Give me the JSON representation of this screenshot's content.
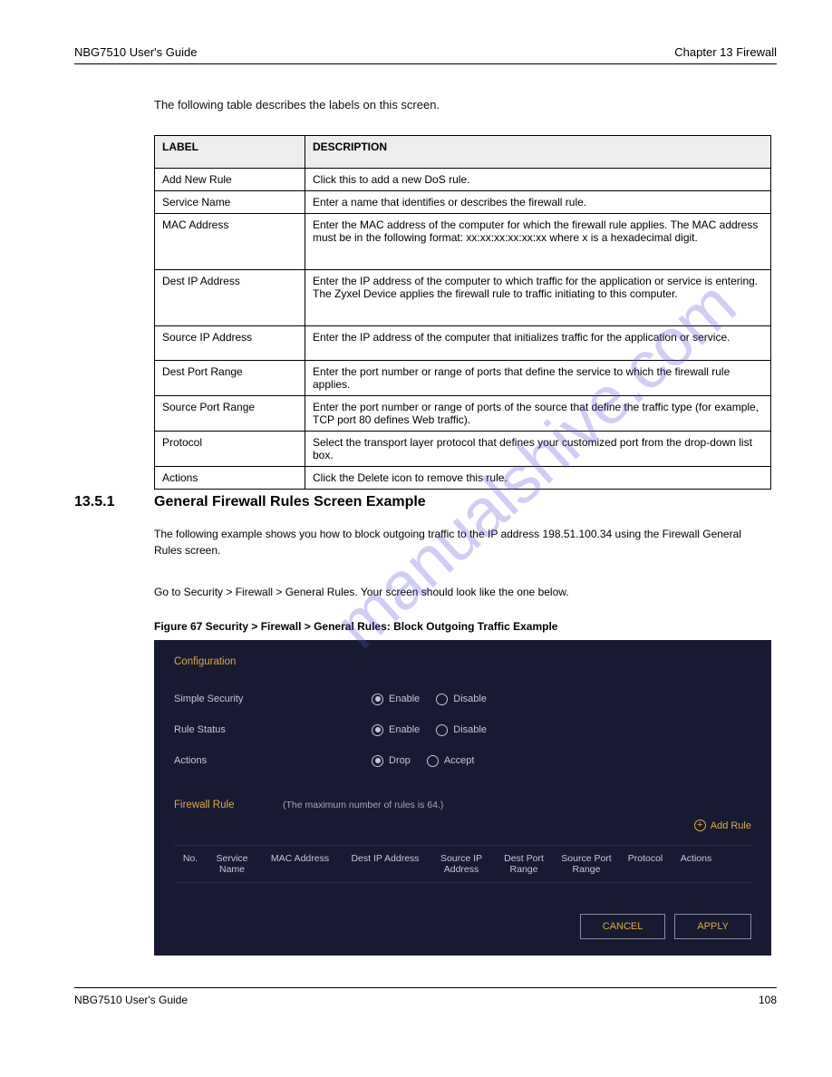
{
  "header": {
    "left": "NBG7510 User's Guide",
    "right": "Chapter 13 Firewall"
  },
  "intro_line": "The following table describes the labels on this screen.",
  "table": {
    "th_label": "LABEL",
    "th_desc": "DESCRIPTION",
    "rows": [
      {
        "label": "Add New Rule",
        "desc": "Click this to add a new DoS rule.",
        "cls": "h1"
      },
      {
        "label": "Service Name",
        "desc": "Enter a name that identifies or describes the firewall rule.",
        "cls": "h1"
      },
      {
        "label": "MAC Address",
        "desc": "Enter the MAC address of the computer for which the firewall rule applies. The MAC address must be in the following format: xx:xx:xx:xx:xx:xx where x is a hexadecimal digit.",
        "cls": "h2"
      },
      {
        "label": "Dest IP Address",
        "desc": "Enter the IP address of the computer to which traffic for the application or service is entering. The Zyxel Device applies the firewall rule to traffic initiating to this computer.",
        "cls": "h2"
      },
      {
        "label": "Source IP Address",
        "desc": "Enter the IP address of the computer that initializes traffic for the application or service.",
        "cls": "h3"
      },
      {
        "label": "Dest Port Range",
        "desc": "Enter the port number or range of ports that define the service to which the firewall rule applies.",
        "cls": "h3"
      },
      {
        "label": "Source Port Range",
        "desc": "Enter the port number or range of ports of the source that define the traffic type (for example, TCP port 80 defines Web traffic).",
        "cls": "h3"
      },
      {
        "label": "Protocol",
        "desc": "Select the transport layer protocol that defines your customized port from the drop-down list box.",
        "cls": "h1"
      },
      {
        "label": "Actions",
        "desc": "Click the Delete icon to remove this rule.",
        "cls": "h1"
      }
    ]
  },
  "section": {
    "number": "13.5.1",
    "title": "General Firewall Rules Screen Example",
    "para1": "The following example shows you how to block outgoing traffic to the IP address 198.51.100.34 using the Firewall General Rules screen.",
    "para2": "Go to Security > Firewall > General Rules. Your screen should look like the one below.",
    "figure_caption": "Figure 67   Security > Firewall > General Rules: Block Outgoing Traffic Example"
  },
  "ui": {
    "config_title": "Configuration",
    "simple_security": {
      "label": "Simple Security",
      "opt1": "Enable",
      "opt2": "Disable",
      "selected": "Enable"
    },
    "rule_status": {
      "label": "Rule Status",
      "opt1": "Enable",
      "opt2": "Disable",
      "selected": "Enable"
    },
    "actions": {
      "label": "Actions",
      "opt1": "Drop",
      "opt2": "Accept",
      "selected": "Drop"
    },
    "firewall_rule_title": "Firewall Rule",
    "firewall_rule_note": "(The maximum number of rules is 64.)",
    "add_rule": "Add Rule",
    "cols": {
      "no": "No.",
      "svc": "Service Name",
      "mac": "MAC Address",
      "dip": "Dest IP Address",
      "sip": "Source IP Address",
      "dpr": "Dest Port Range",
      "spr": "Source Port Range",
      "proto": "Protocol",
      "act": "Actions"
    },
    "cancel": "CANCEL",
    "apply": "APPLY"
  },
  "footer": {
    "left": "NBG7510 User's Guide",
    "right": "108"
  },
  "watermark": "manualshive.com"
}
